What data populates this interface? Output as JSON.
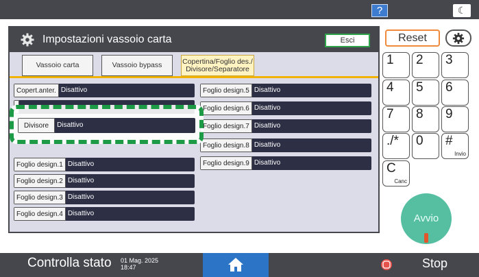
{
  "topbar": {
    "help_label": "?",
    "mode_label": "☾"
  },
  "panel": {
    "title": "Impostazioni vassoio carta",
    "exit_label": "Esci",
    "tabs": [
      {
        "label": "Vassoio carta"
      },
      {
        "label": "Vassoio bypass"
      },
      {
        "label": "Copertina/Foglio des./ Divisore/Separatore"
      }
    ],
    "left_rows": [
      {
        "label": "Copert.anter.",
        "value": "Disattivo"
      },
      {
        "label": "Divisore",
        "value": "Disattivo"
      },
      {
        "label": "Foglio design.1",
        "value": "Disattivo"
      },
      {
        "label": "Foglio design.2",
        "value": "Disattivo"
      },
      {
        "label": "Foglio design.3",
        "value": "Disattivo"
      },
      {
        "label": "Foglio design.4",
        "value": "Disattivo"
      }
    ],
    "right_rows": [
      {
        "label": "Foglio design.5",
        "value": "Disattivo"
      },
      {
        "label": "Foglio design.6",
        "value": "Disattivo"
      },
      {
        "label": "Foglio design.7",
        "value": "Disattivo"
      },
      {
        "label": "Foglio design.8",
        "value": "Disattivo"
      },
      {
        "label": "Foglio design.9",
        "value": "Disattivo"
      }
    ]
  },
  "keypad": {
    "reset_label": "Reset",
    "keys": [
      {
        "label": "1",
        "sub": ""
      },
      {
        "label": "2",
        "sub": ""
      },
      {
        "label": "3",
        "sub": ""
      },
      {
        "label": "4",
        "sub": ""
      },
      {
        "label": "5",
        "sub": ""
      },
      {
        "label": "6",
        "sub": ""
      },
      {
        "label": "7",
        "sub": ""
      },
      {
        "label": "8",
        "sub": ""
      },
      {
        "label": "9",
        "sub": ""
      },
      {
        "label": "./*",
        "sub": ""
      },
      {
        "label": "0",
        "sub": ""
      },
      {
        "label": "#",
        "sub": "Invio"
      },
      {
        "label": "C",
        "sub": "Canc"
      }
    ],
    "start_label": "Avvio"
  },
  "bottombar": {
    "status_label": "Controlla stato",
    "date": "01 Mag. 2025",
    "time": "18:47",
    "stop_label": "Stop"
  },
  "colors": {
    "accent_green": "#1d9a45",
    "tab_active": "#f0b400",
    "value_bg": "#2d2f45",
    "start": "#56bfa2"
  }
}
